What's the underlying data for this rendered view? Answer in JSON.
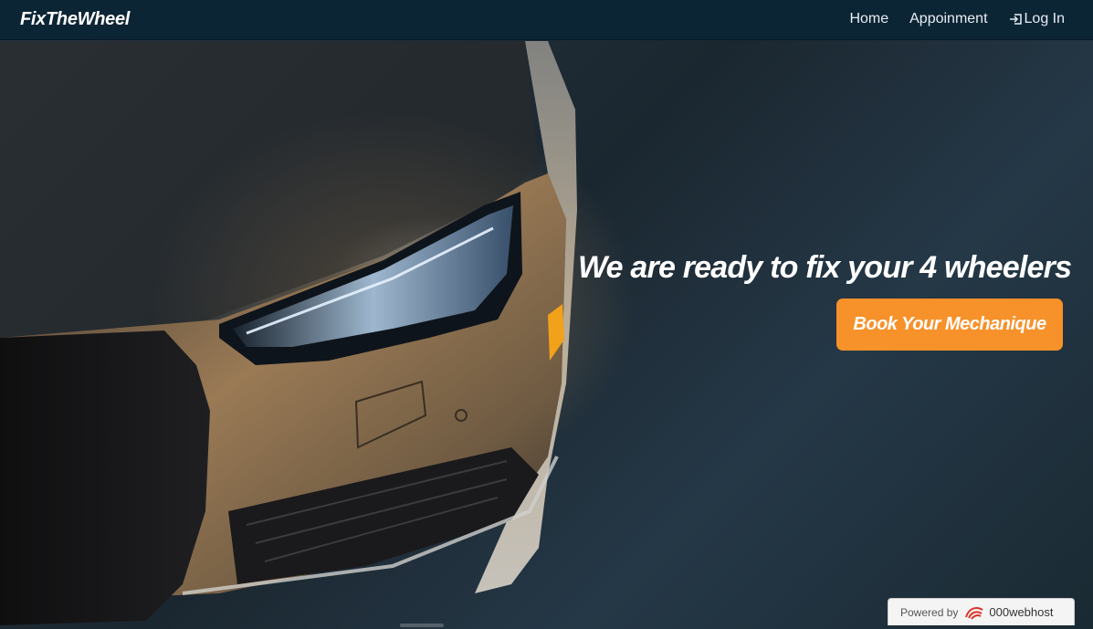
{
  "navbar": {
    "brand": "FixTheWheel",
    "links": [
      {
        "label": "Home"
      },
      {
        "label": "Appoinment"
      },
      {
        "label": "Log In",
        "icon": "login-icon"
      }
    ]
  },
  "hero": {
    "headline": "We are ready to fix your 4 wheelers",
    "cta_label": "Book Your Mechanique",
    "cta_color": "#f7912a"
  },
  "footer_badge": {
    "powered_by": "Powered by",
    "host": "000webhost",
    "icon": "000webhost-logo-icon"
  },
  "colors": {
    "navbar_bg": "#0c2535",
    "accent": "#f7912a"
  }
}
